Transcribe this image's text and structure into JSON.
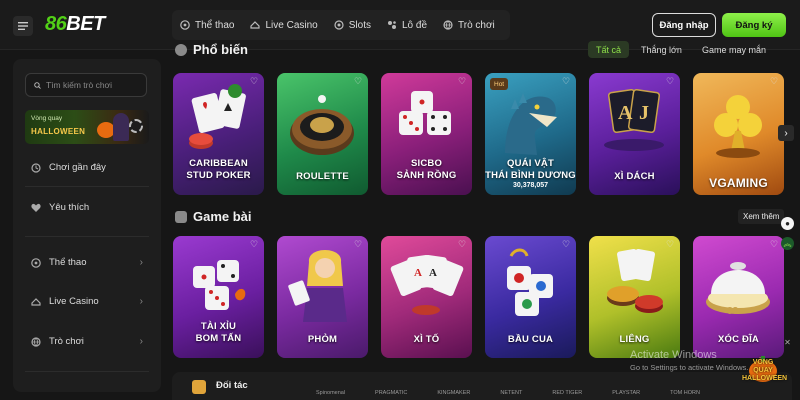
{
  "header": {
    "logo_green": "86",
    "logo_white": "BET",
    "nav": [
      {
        "label": "Thể thao",
        "icon": "soccer-ball-icon"
      },
      {
        "label": "Live Casino",
        "icon": "casino-table-icon"
      },
      {
        "label": "Slots",
        "icon": "slot-icon"
      },
      {
        "label": "Lô đề",
        "icon": "lottery-icon"
      },
      {
        "label": "Trò chơi",
        "icon": "globe-icon"
      }
    ],
    "login_label": "Đăng nhập",
    "register_label": "Đăng ký"
  },
  "sidebar": {
    "search_placeholder": "Tìm kiếm trò chơi",
    "banner": {
      "line1": "Vòng quay",
      "line2": "HALLOWEEN"
    },
    "items": [
      {
        "label": "Chơi gần đây",
        "icon": "clock-icon"
      },
      {
        "label": "Yêu thích",
        "icon": "heart-icon"
      },
      {
        "label": "Thể thao",
        "icon": "soccer-ball-icon"
      },
      {
        "label": "Live Casino",
        "icon": "casino-table-icon"
      },
      {
        "label": "Trò chơi",
        "icon": "globe-icon"
      }
    ]
  },
  "popular": {
    "title": "Phổ biến",
    "tabs": [
      {
        "label": "Tất cả",
        "active": true
      },
      {
        "label": "Thắng lớn",
        "active": false
      },
      {
        "label": "Game may mắn",
        "active": false
      }
    ],
    "cards": [
      {
        "label_line1": "CARIBBEAN",
        "label_line2": "STUD POKER"
      },
      {
        "label_line1": "ROULETTE",
        "label_line2": ""
      },
      {
        "label_line1": "SICBO",
        "label_line2": "SẢNH RỒNG"
      },
      {
        "label_line1": "QUÁI VẬT",
        "label_line2": "THÁI BÌNH DƯƠNG",
        "badge": "Hot",
        "count": "30,378,057"
      },
      {
        "label_line1": "XÌ DÁCH",
        "label_line2": ""
      },
      {
        "label_line1": "VGAMING",
        "label_line2": ""
      }
    ]
  },
  "card_games": {
    "title": "Game bài",
    "see_more": "Xem thêm",
    "cards": [
      {
        "label_line1": "TÀI XỈU",
        "label_line2": "BOM TẤN"
      },
      {
        "label_line1": "PHỎM",
        "label_line2": ""
      },
      {
        "label_line1": "XÌ TỐ",
        "label_line2": ""
      },
      {
        "label_line1": "BẦU CUA",
        "label_line2": ""
      },
      {
        "label_line1": "LIÊNG",
        "label_line2": ""
      },
      {
        "label_line1": "XÓC ĐĨA",
        "label_line2": ""
      }
    ]
  },
  "partners": {
    "title": "Đối tác",
    "logos": [
      "Spinomenal",
      "PRAGMATIC",
      "KINGMAKER",
      "NETENT",
      "RED TIGER",
      "PLAYSTAR",
      "TOM HORN"
    ]
  },
  "overlay": {
    "activate_line1": "Activate Windows",
    "activate_line2": "Go to Settings to activate Windows.",
    "halloween_line1": "VÒNG QUAY",
    "halloween_line2": "HALLOWEEN"
  },
  "colors": {
    "accent": "#52d017",
    "background": "#161616",
    "panel": "#1e1e1e"
  }
}
